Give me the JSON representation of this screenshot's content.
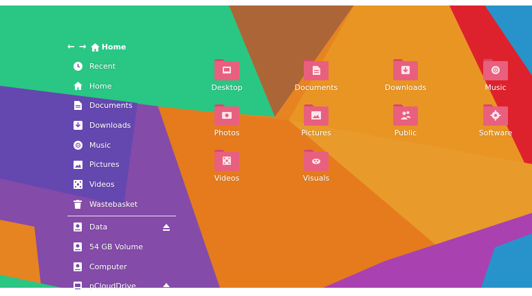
{
  "navigation": {
    "back_icon": "arrow-left-icon",
    "forward_icon": "arrow-right-icon",
    "location": "Home"
  },
  "sidebar": {
    "places": [
      {
        "label": "Recent",
        "icon": "clock-icon"
      },
      {
        "label": "Home",
        "icon": "home-icon"
      },
      {
        "label": "Documents",
        "icon": "document-icon"
      },
      {
        "label": "Downloads",
        "icon": "download-icon"
      },
      {
        "label": "Music",
        "icon": "music-icon"
      },
      {
        "label": "Pictures",
        "icon": "picture-icon"
      },
      {
        "label": "Videos",
        "icon": "video-icon"
      },
      {
        "label": "Wastebasket",
        "icon": "trash-icon"
      }
    ],
    "devices": [
      {
        "label": "Data",
        "icon": "drive-icon",
        "eject": true
      },
      {
        "label": "54 GB Volume",
        "icon": "drive-icon",
        "eject": false
      },
      {
        "label": "Computer",
        "icon": "drive-icon",
        "eject": false
      },
      {
        "label": "pCloudDrive",
        "icon": "drive-icon",
        "eject": true
      }
    ]
  },
  "files": [
    {
      "label": "Desktop",
      "icon": "desktop-folder-icon"
    },
    {
      "label": "Documents",
      "icon": "documents-folder-icon"
    },
    {
      "label": "Downloads",
      "icon": "downloads-folder-icon"
    },
    {
      "label": "Music",
      "icon": "music-folder-icon"
    },
    {
      "label": "Photos",
      "icon": "photos-folder-icon"
    },
    {
      "label": "Pictures",
      "icon": "pictures-folder-icon"
    },
    {
      "label": "Public",
      "icon": "public-folder-icon"
    },
    {
      "label": "Software",
      "icon": "software-folder-icon"
    },
    {
      "label": "Videos",
      "icon": "videos-folder-icon"
    },
    {
      "label": "Visuals",
      "icon": "visuals-folder-icon"
    }
  ],
  "colors": {
    "folder": "#e8607e",
    "folder_tab": "#d9486a",
    "folder_glyph": "#fde3ea"
  }
}
